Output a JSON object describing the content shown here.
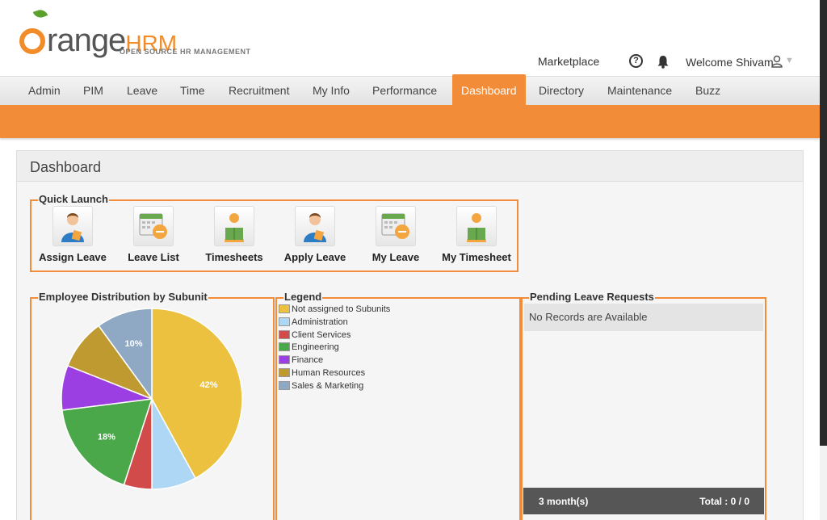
{
  "header": {
    "logo_orange": "range",
    "logo_hrm": "HRM",
    "logo_tagline": "OPEN SOURCE HR MANAGEMENT",
    "marketplace": "Marketplace",
    "welcome": "Welcome Shivam",
    "icons": [
      "help-icon",
      "bell-icon",
      "user-icon",
      "chevron-down-icon"
    ]
  },
  "nav": {
    "items": [
      {
        "label": "Admin"
      },
      {
        "label": "PIM"
      },
      {
        "label": "Leave"
      },
      {
        "label": "Time"
      },
      {
        "label": "Recruitment"
      },
      {
        "label": "My Info"
      },
      {
        "label": "Performance"
      },
      {
        "label": "Dashboard",
        "active": true
      },
      {
        "label": "Directory"
      },
      {
        "label": "Maintenance"
      },
      {
        "label": "Buzz"
      }
    ]
  },
  "panel": {
    "title": "Dashboard"
  },
  "quick_launch": {
    "title": "Quick Launch",
    "items": [
      {
        "label": "Assign Leave",
        "icon": "user-assign-icon"
      },
      {
        "label": "Leave List",
        "icon": "calendar-list-icon"
      },
      {
        "label": "Timesheets",
        "icon": "timesheets-icon"
      },
      {
        "label": "Apply Leave",
        "icon": "user-apply-icon"
      },
      {
        "label": "My Leave",
        "icon": "calendar-leave-icon"
      },
      {
        "label": "My Timesheet",
        "icon": "my-timesheet-icon"
      }
    ]
  },
  "distribution": {
    "title": "Employee Distribution by Subunit"
  },
  "legend": {
    "title": "Legend"
  },
  "chart_data": {
    "type": "pie",
    "slices": [
      {
        "label": "Not assigned to Subunits",
        "value": 42,
        "color": "#ecc13f",
        "show_label": "42%"
      },
      {
        "label": "Administration",
        "value": 8,
        "color": "#aed6f5",
        "show_label": ""
      },
      {
        "label": "Client Services",
        "value": 5,
        "color": "#d24b4b",
        "show_label": ""
      },
      {
        "label": "Engineering",
        "value": 18,
        "color": "#4aa84a",
        "show_label": "18%"
      },
      {
        "label": "Finance",
        "value": 8,
        "color": "#9b3fe3",
        "show_label": ""
      },
      {
        "label": "Human Resources",
        "value": 9,
        "color": "#bf9a30",
        "show_label": ""
      },
      {
        "label": "Sales & Marketing",
        "value": 10,
        "color": "#8fa9c4",
        "show_label": "10%"
      }
    ]
  },
  "pending": {
    "title": "Pending Leave Requests",
    "empty": "No Records are Available",
    "period": "3 month(s)",
    "total": "Total : 0 / 0"
  }
}
